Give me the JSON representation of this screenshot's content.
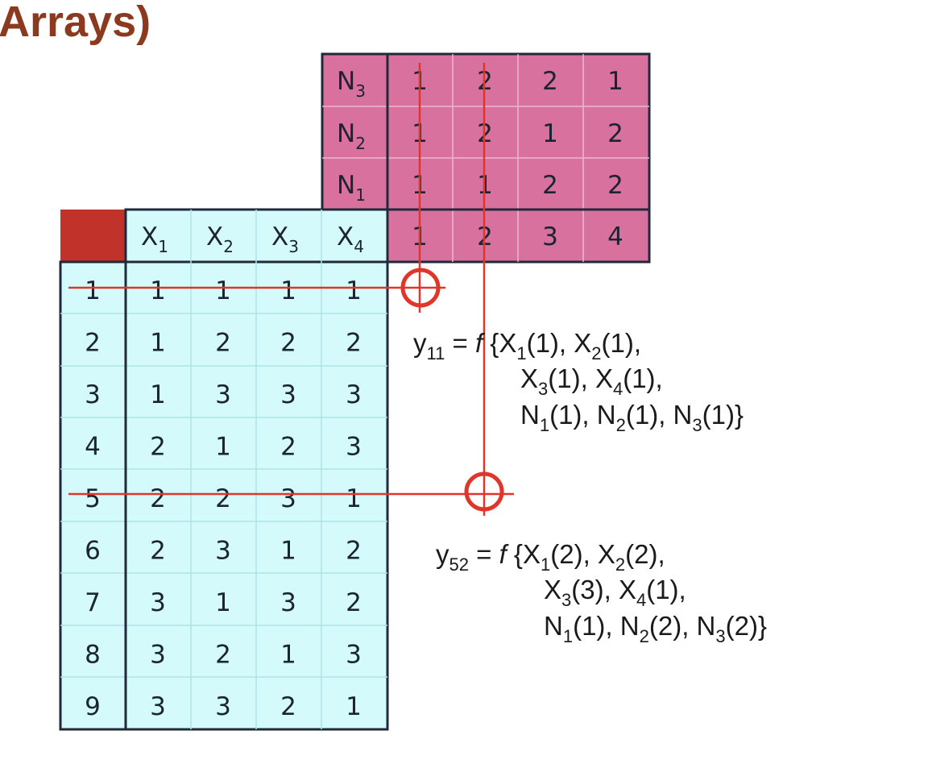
{
  "title": "Arrays)",
  "colors": {
    "title": "#8b3a1f",
    "outer_array_fill": "#d9719e",
    "inner_array_fill": "#d4fafc",
    "corner_fill": "#c0322a",
    "border": "#1f2a3a",
    "marker": "#e0362a"
  },
  "outer_array": {
    "row_labels": [
      {
        "base": "N",
        "sub": "3"
      },
      {
        "base": "N",
        "sub": "2"
      },
      {
        "base": "N",
        "sub": "1"
      }
    ],
    "rows": [
      [
        "1",
        "2",
        "2",
        "1"
      ],
      [
        "1",
        "2",
        "1",
        "2"
      ],
      [
        "1",
        "1",
        "2",
        "2"
      ]
    ],
    "run_numbers": [
      "1",
      "2",
      "3",
      "4"
    ]
  },
  "inner_array": {
    "headers": [
      {
        "base": "X",
        "sub": "1"
      },
      {
        "base": "X",
        "sub": "2"
      },
      {
        "base": "X",
        "sub": "3"
      },
      {
        "base": "X",
        "sub": "4"
      }
    ],
    "run_numbers": [
      "1",
      "2",
      "3",
      "4",
      "5",
      "6",
      "7",
      "8",
      "9"
    ],
    "rows": [
      [
        "1",
        "1",
        "1",
        "1"
      ],
      [
        "1",
        "2",
        "2",
        "2"
      ],
      [
        "1",
        "3",
        "3",
        "3"
      ],
      [
        "2",
        "1",
        "2",
        "3"
      ],
      [
        "2",
        "2",
        "3",
        "1"
      ],
      [
        "2",
        "3",
        "1",
        "2"
      ],
      [
        "3",
        "1",
        "3",
        "2"
      ],
      [
        "3",
        "2",
        "1",
        "3"
      ],
      [
        "3",
        "3",
        "2",
        "1"
      ]
    ]
  },
  "formula_y11": {
    "line1": {
      "y": "y",
      "ysub": "11",
      "eq": " = ",
      "f": "f",
      "open": " {",
      "a": "X",
      "asub": "1",
      "av": "(1), ",
      "b": "X",
      "bsub": "2",
      "bv": "(1),"
    },
    "line2": {
      "a": "X",
      "asub": "3",
      "av": "(1), ",
      "b": "X",
      "bsub": "4",
      "bv": "(1),"
    },
    "line3": {
      "a": "N",
      "asub": "1",
      "av": "(1), ",
      "b": "N",
      "bsub": "2",
      "bv": "(1), ",
      "c": "N",
      "csub": "3",
      "cv": "(1)}"
    }
  },
  "formula_y52": {
    "line1": {
      "y": "y",
      "ysub": "52",
      "eq": " = ",
      "f": "f",
      "open": " {",
      "a": "X",
      "asub": "1",
      "av": "(2), ",
      "b": "X",
      "bsub": "2",
      "bv": "(2),"
    },
    "line2": {
      "a": "X",
      "asub": "3",
      "av": "(3), ",
      "b": "X",
      "bsub": "4",
      "bv": "(1),"
    },
    "line3": {
      "a": "N",
      "asub": "1",
      "av": "(1), ",
      "b": "N",
      "bsub": "2",
      "bv": "(2), ",
      "c": "N",
      "csub": "3",
      "cv": "(2)}"
    }
  }
}
